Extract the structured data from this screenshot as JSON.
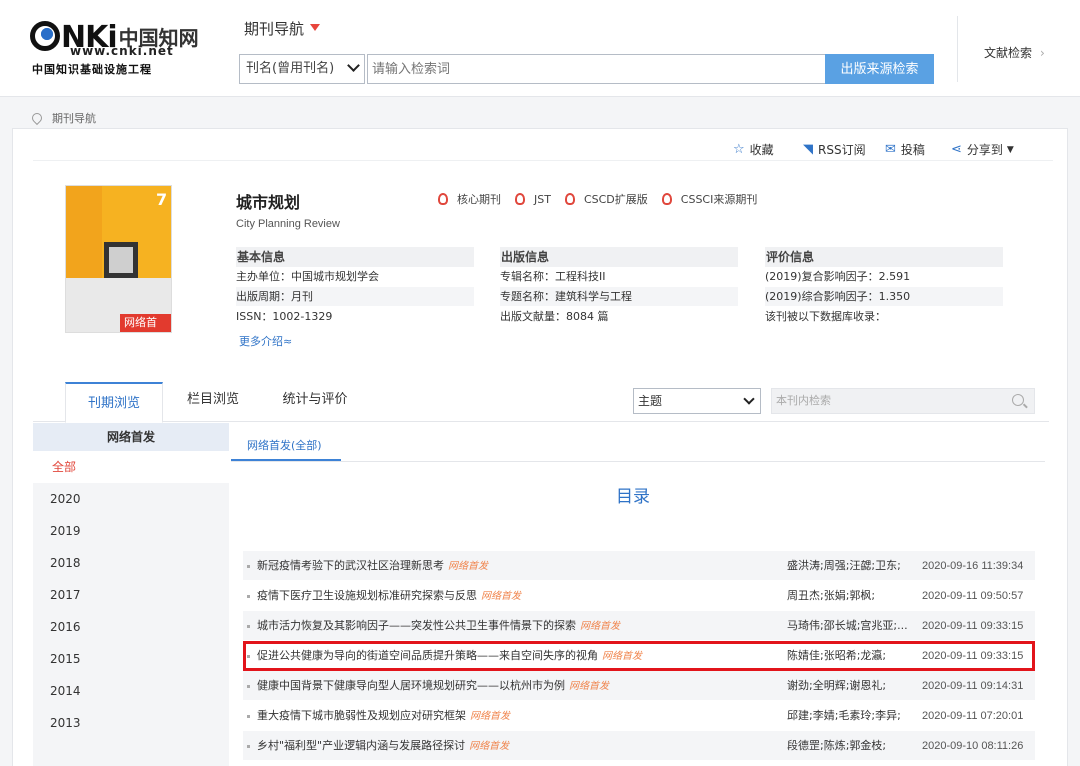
{
  "logo": {
    "brand": "CNKi",
    "cn_name": "中国知网",
    "url": "www.cnki.net",
    "subtitle": "中国知识基础设施工程"
  },
  "header": {
    "nav_title": "期刊导航",
    "search_type": "刊名(曾用刊名)",
    "search_placeholder": "请输入检索词",
    "search_button": "出版来源检索",
    "doc_search": "文献检索",
    "doc_search_arrow": "›"
  },
  "breadcrumb": {
    "label": "期刊导航"
  },
  "toolbar": {
    "favorite": "收藏",
    "rss": "RSS订阅",
    "submit": "投稿",
    "share": "分享到"
  },
  "journal": {
    "cover_badge": "网络首发",
    "cover_issue": "7",
    "title": "城市规划",
    "subtitle_en": "City Planning Review",
    "tags": [
      "核心期刊",
      "JST",
      "CSCD扩展版",
      "CSSCI来源期刊"
    ],
    "basic": {
      "heading": "基本信息",
      "rows": [
        "主办单位：中国城市规划学会",
        "出版周期：月刊",
        "ISSN：1002-1329"
      ]
    },
    "publish": {
      "heading": "出版信息",
      "rows": [
        "专辑名称：工程科技II",
        "专题名称：建筑科学与工程",
        "出版文献量：8084 篇"
      ]
    },
    "eval": {
      "heading": "评价信息",
      "rows": [
        "(2019)复合影响因子：2.591",
        "(2019)综合影响因子：1.350",
        "该刊被以下数据库收录："
      ]
    },
    "more": "更多介绍≈"
  },
  "tabs": {
    "issue": "刊期浏览",
    "column": "栏目浏览",
    "stats": "统计与评价"
  },
  "filter": {
    "topic": "主题",
    "inner_search_placeholder": "本刊内检索"
  },
  "sidebar": {
    "heading": "网络首发",
    "items": [
      "全部",
      "2020",
      "2019",
      "2018",
      "2017",
      "2016",
      "2015",
      "2014",
      "2013"
    ]
  },
  "content": {
    "subtab": "网络首发(全部)",
    "toc_title": "目录",
    "online_first": "网络首发",
    "articles": [
      {
        "title": "新冠疫情考验下的武汉社区治理新思考",
        "authors": "盛洪涛;周强;汪勰;卫东;",
        "date": "2020-09-16 11:39:34"
      },
      {
        "title": "疫情下医疗卫生设施规划标准研究探索与反思",
        "authors": "周丑杰;张娟;郭枫;",
        "date": "2020-09-11 09:50:57"
      },
      {
        "title": "城市活力恢复及其影响因子——突发性公共卫生事件情景下的探索",
        "authors": "马琦伟;邵长城;宫兆亚;...",
        "date": "2020-09-11 09:33:15"
      },
      {
        "title": "促进公共健康为导向的街道空间品质提升策略——来自空间失序的视角",
        "authors": "陈婧佳;张昭希;龙瀛;",
        "date": "2020-09-11 09:33:15"
      },
      {
        "title": "健康中国背景下健康导向型人居环境规划研究——以杭州市为例",
        "authors": "谢劲;全明辉;谢恩礼;",
        "date": "2020-09-11 09:14:31"
      },
      {
        "title": "重大疫情下城市脆弱性及规划应对研究框架",
        "authors": "邱建;李婧;毛素玲;李异;",
        "date": "2020-09-11 07:20:01"
      },
      {
        "title": "乡村\"福利型\"产业逻辑内涵与发展路径探讨",
        "authors": "段德罡;陈炼;郭金枝;",
        "date": "2020-09-10 08:11:26"
      }
    ]
  },
  "colors": {
    "accent": "#2f73c7",
    "highlight": "#e2141b",
    "search_button": "#5aa1e3"
  }
}
